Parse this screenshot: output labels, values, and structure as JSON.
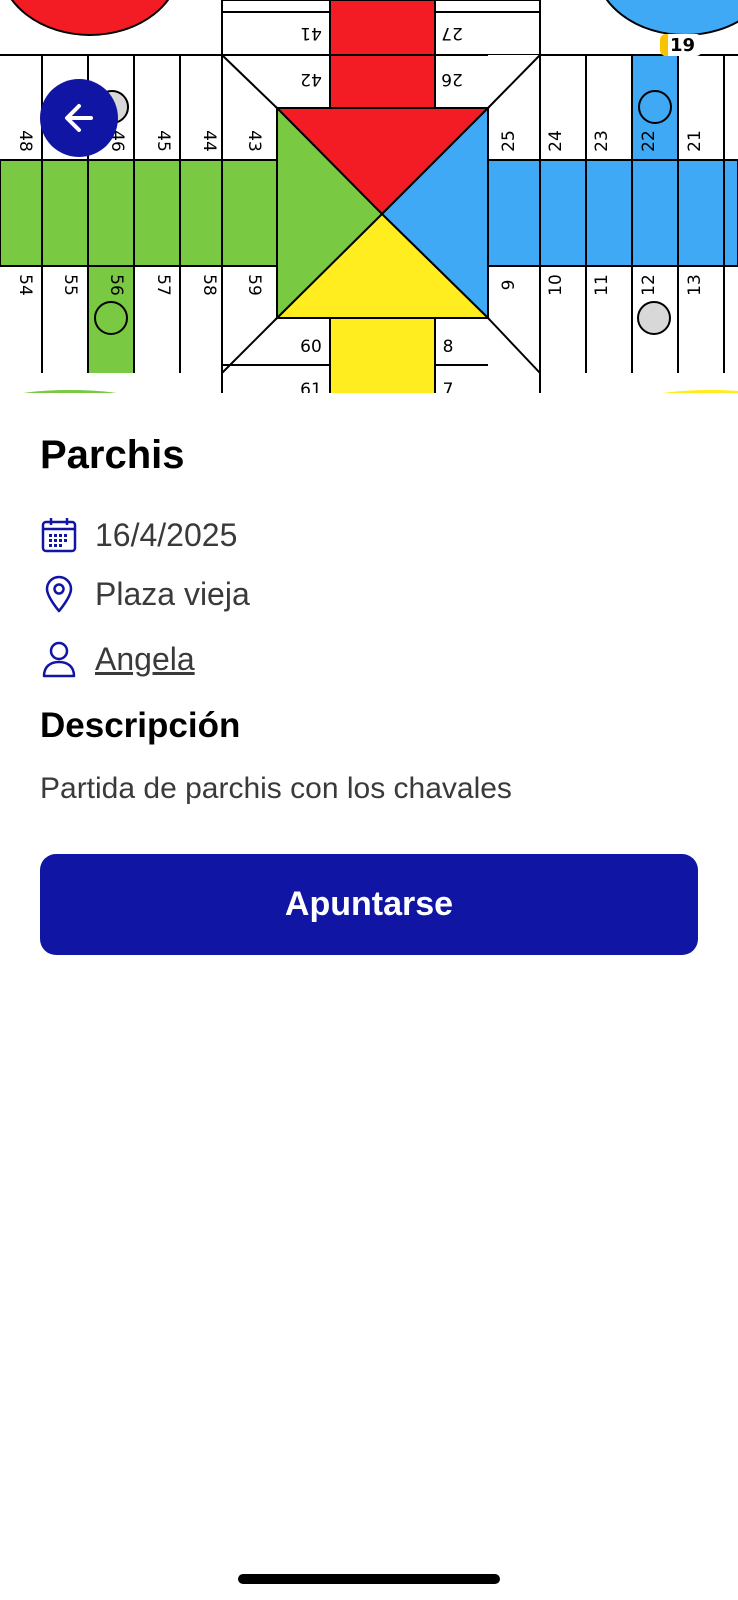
{
  "status_bar": {
    "battery": "19",
    "battery_level": 0.19
  },
  "hero": {
    "image": "parchis-board-illustration",
    "board_numbers": [
      "41",
      "27",
      "42",
      "26",
      "48",
      "46",
      "45",
      "44",
      "43",
      "25",
      "24",
      "23",
      "22",
      "21",
      "54",
      "55",
      "56",
      "57",
      "58",
      "59",
      "9",
      "10",
      "11",
      "12",
      "13",
      "60",
      "8",
      "61",
      "7"
    ],
    "colors": {
      "red": "#f41c24",
      "green": "#7ac943",
      "blue": "#3fa9f5",
      "yellow": "#ffed1f"
    }
  },
  "nav": {
    "back_icon": "arrow-left-icon"
  },
  "event": {
    "title": "Parchis",
    "date": "16/4/2025",
    "location": "Plaza vieja",
    "organizer": "Angela",
    "description_heading": "Descripción",
    "description": "Partida de parchis con los chavales"
  },
  "actions": {
    "join_label": "Apuntarse"
  },
  "theme": {
    "accent": "#1016a3",
    "text_secondary": "#3a3a3a"
  }
}
